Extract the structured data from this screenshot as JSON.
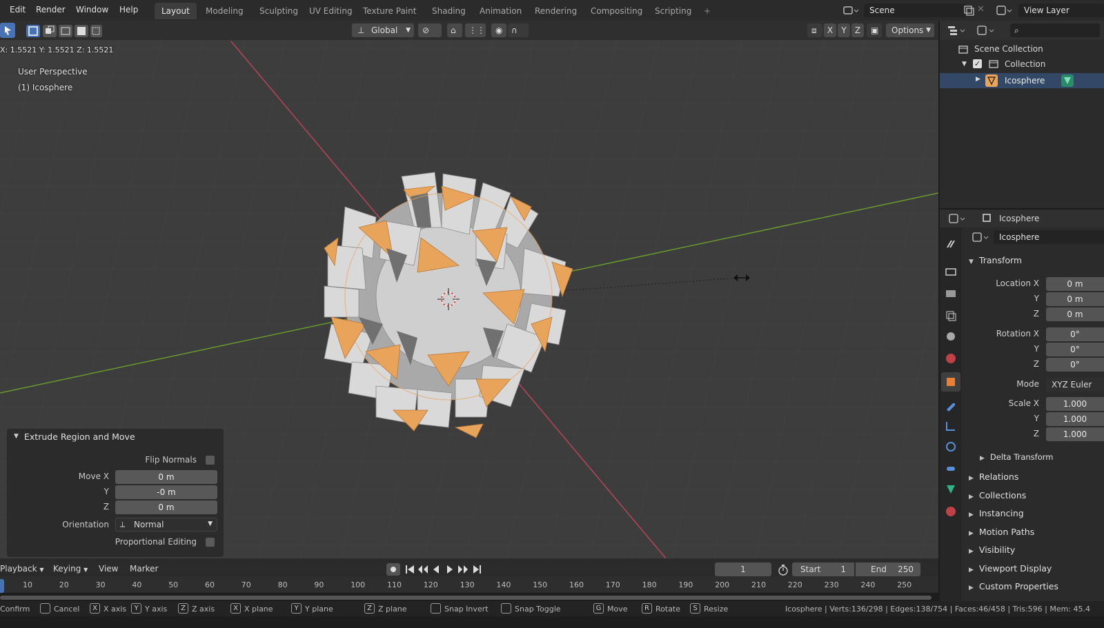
{
  "menu": [
    "Edit",
    "Render",
    "Window",
    "Help"
  ],
  "workspaces": [
    {
      "label": "Layout",
      "active": true
    },
    {
      "label": "Modeling"
    },
    {
      "label": "Sculpting"
    },
    {
      "label": "UV Editing"
    },
    {
      "label": "Texture Paint"
    },
    {
      "label": "Shading"
    },
    {
      "label": "Animation"
    },
    {
      "label": "Rendering"
    },
    {
      "label": "Compositing"
    },
    {
      "label": "Scripting"
    }
  ],
  "add_tab": "+",
  "scene": {
    "name": "Scene",
    "view_layer": "View Layer"
  },
  "viewport": {
    "orientation": "Global",
    "options": "Options",
    "axis_toggles": [
      "X",
      "Y",
      "Z"
    ],
    "readout": "X: 1.5521   Y: 1.5521   Z: 1.5521",
    "perspective": "User Perspective",
    "object": "(1) Icosphere"
  },
  "operator": {
    "title": "Extrude Region and Move",
    "flip_normals": "Flip Normals",
    "move_x_label": "Move X",
    "move_x": "0 m",
    "y_label": "Y",
    "move_y": "-0 m",
    "z_label": "Z",
    "move_z": "0 m",
    "orientation_label": "Orientation",
    "orientation": "Normal",
    "proportional": "Proportional Editing"
  },
  "timeline": {
    "playback": "Playback",
    "keying": "Keying",
    "view": "View",
    "marker": "Marker",
    "current_frame": "1",
    "start_label": "Start",
    "start": "1",
    "end_label": "End",
    "end": "250",
    "ticks": [
      "10",
      "20",
      "30",
      "40",
      "50",
      "60",
      "70",
      "80",
      "90",
      "100",
      "110",
      "120",
      "130",
      "140",
      "150",
      "160",
      "170",
      "180",
      "190",
      "200",
      "210",
      "220",
      "230",
      "240",
      "250"
    ]
  },
  "status": {
    "items": [
      {
        "key": "",
        "label": "Confirm"
      },
      {
        "key": "",
        "label": "Cancel"
      },
      {
        "key": "X",
        "label": "X axis"
      },
      {
        "key": "Y",
        "label": "Y axis"
      },
      {
        "key": "Z",
        "label": "Z axis"
      },
      {
        "key": "X",
        "label": "X plane"
      },
      {
        "key": "Y",
        "label": "Y plane"
      },
      {
        "key": "Z",
        "label": "Z plane"
      },
      {
        "key": "",
        "label": "Snap Invert"
      },
      {
        "key": "",
        "label": "Snap Toggle"
      },
      {
        "key": "G",
        "label": "Move"
      },
      {
        "key": "R",
        "label": "Rotate"
      },
      {
        "key": "S",
        "label": "Resize"
      }
    ],
    "stats": "Icosphere | Verts:136/298 | Edges:138/754 | Faces:46/458 | Tris:596 | Mem: 45.4"
  },
  "outliner": {
    "scene_collection": "Scene Collection",
    "collection": "Collection",
    "object": "Icosphere"
  },
  "properties": {
    "object_name": "Icosphere",
    "data_name": "Icosphere",
    "transform": "Transform",
    "location_x_label": "Location X",
    "location": [
      "0 m",
      "0 m",
      "0 m"
    ],
    "rotation_x_label": "Rotation X",
    "rotation": [
      "0°",
      "0°",
      "0°"
    ],
    "mode_label": "Mode",
    "mode": "XYZ Euler",
    "scale_x_label": "Scale X",
    "scale": [
      "1.000",
      "1.000",
      "1.000"
    ],
    "y_label": "Y",
    "z_label": "Z",
    "delta": "Delta Transform",
    "sections": [
      "Relations",
      "Collections",
      "Instancing",
      "Motion Paths",
      "Visibility",
      "Viewport Display",
      "Custom Properties"
    ]
  },
  "colors": {
    "accent": "#4772b3",
    "selected": "#e8a45a",
    "x_axis": "#b5465a",
    "y_axis": "#6a9a2e"
  }
}
